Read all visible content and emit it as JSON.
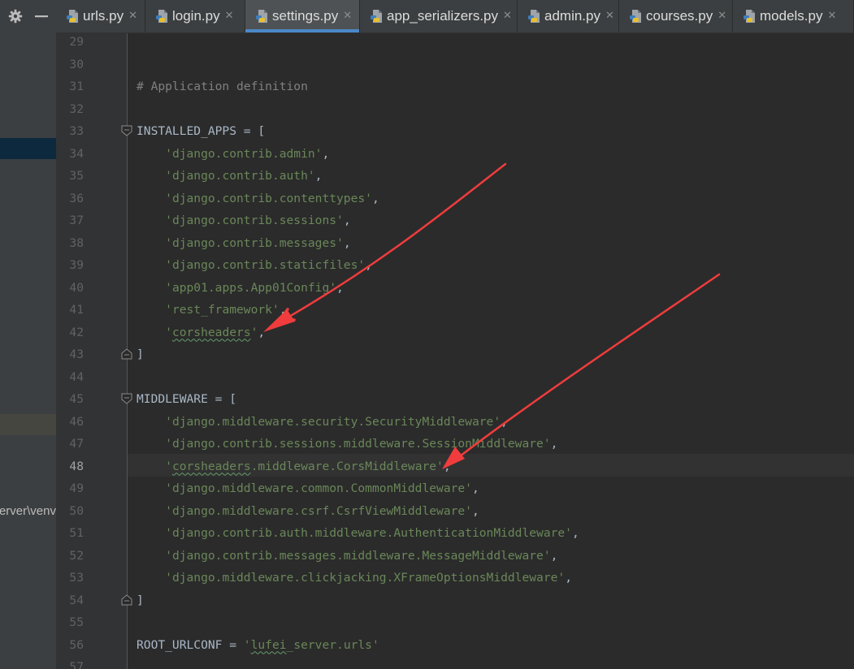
{
  "project_panel": {
    "path_fragment": "lufei_server\\venv"
  },
  "tabs": [
    {
      "label": "urls.py",
      "active": false
    },
    {
      "label": "login.py",
      "active": false
    },
    {
      "label": "settings.py",
      "active": true
    },
    {
      "label": "app_serializers.py",
      "active": false
    },
    {
      "label": "admin.py",
      "active": false
    },
    {
      "label": "courses.py",
      "active": false
    },
    {
      "label": "models.py",
      "active": false
    }
  ],
  "editor": {
    "current_line": 48,
    "lines": [
      {
        "n": "29",
        "code": ""
      },
      {
        "n": "30",
        "code": ""
      },
      {
        "n": "31",
        "code": "# Application definition"
      },
      {
        "n": "32",
        "code": ""
      },
      {
        "n": "33",
        "code": "INSTALLED_APPS = ["
      },
      {
        "n": "34",
        "code": "    'django.contrib.admin',"
      },
      {
        "n": "35",
        "code": "    'django.contrib.auth',"
      },
      {
        "n": "36",
        "code": "    'django.contrib.contenttypes',"
      },
      {
        "n": "37",
        "code": "    'django.contrib.sessions',"
      },
      {
        "n": "38",
        "code": "    'django.contrib.messages',"
      },
      {
        "n": "39",
        "code": "    'django.contrib.staticfiles',"
      },
      {
        "n": "40",
        "code": "    'app01.apps.App01Config',"
      },
      {
        "n": "41",
        "code": "    'rest_framework',"
      },
      {
        "n": "42",
        "code": "    'corsheaders',"
      },
      {
        "n": "43",
        "code": "]"
      },
      {
        "n": "44",
        "code": ""
      },
      {
        "n": "45",
        "code": "MIDDLEWARE = ["
      },
      {
        "n": "46",
        "code": "    'django.middleware.security.SecurityMiddleware',"
      },
      {
        "n": "47",
        "code": "    'django.contrib.sessions.middleware.SessionMiddleware',"
      },
      {
        "n": "48",
        "code": "    'corsheaders.middleware.CorsMiddleware',"
      },
      {
        "n": "49",
        "code": "    'django.middleware.common.CommonMiddleware',"
      },
      {
        "n": "50",
        "code": "    'django.middleware.csrf.CsrfViewMiddleware',"
      },
      {
        "n": "51",
        "code": "    'django.contrib.auth.middleware.AuthenticationMiddleware',"
      },
      {
        "n": "52",
        "code": "    'django.contrib.messages.middleware.MessageMiddleware',"
      },
      {
        "n": "53",
        "code": "    'django.middleware.clickjacking.XFrameOptionsMiddleware',"
      },
      {
        "n": "54",
        "code": "]"
      },
      {
        "n": "55",
        "code": ""
      },
      {
        "n": "56",
        "code": "ROOT_URLCONF = 'lufei_server.urls'"
      },
      {
        "n": "57",
        "code": ""
      }
    ]
  },
  "icons": {
    "settings": "gear-icon",
    "hide": "minimize-icon",
    "python_file": "python-file-icon",
    "close_tab": "close-icon",
    "fold": "fold-marker-icon"
  },
  "colors": {
    "accent": "#4a88c7",
    "annotation_arrow": "#f03c3c",
    "string": "#6a8759",
    "comment": "#808080"
  }
}
